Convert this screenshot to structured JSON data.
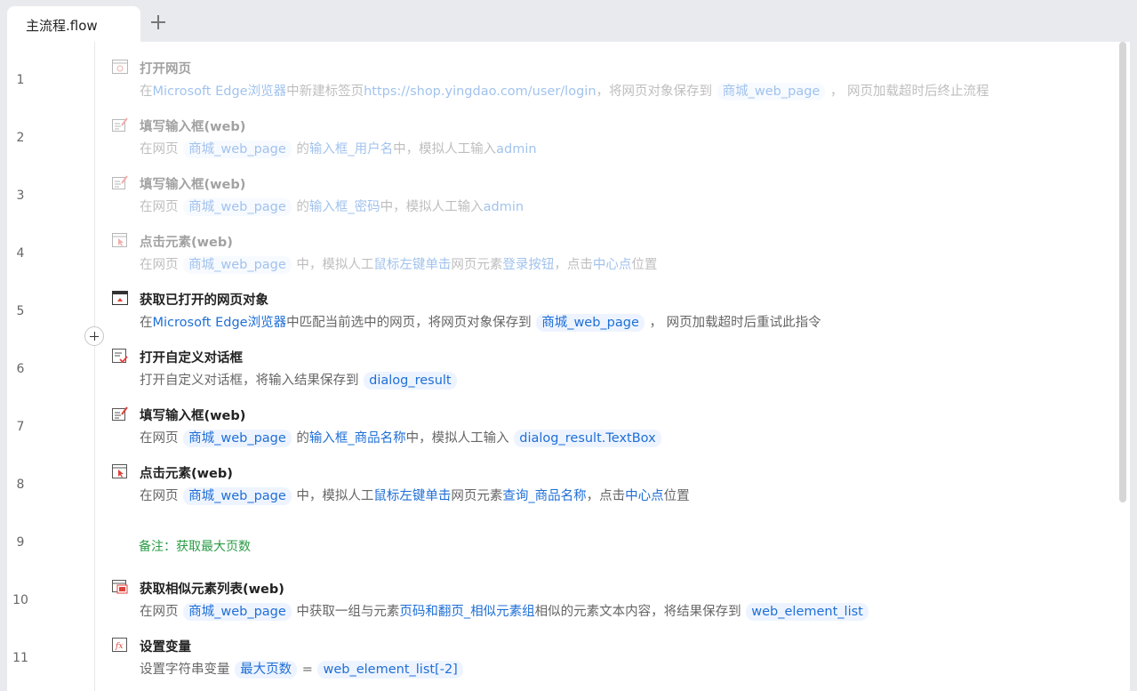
{
  "tabs": {
    "active_label": "主流程.flow",
    "add_label": "+"
  },
  "line_numbers": [
    "1",
    "2",
    "3",
    "4",
    "5",
    "6",
    "7",
    "8",
    "9",
    "10",
    "11"
  ],
  "steps": [
    {
      "title": "打开网页",
      "icon": "browser-open-icon",
      "disabled": true,
      "desc": [
        {
          "t": "在"
        },
        {
          "t": "Microsoft Edge浏览器",
          "k": "hl"
        },
        {
          "t": "中新建标签页"
        },
        {
          "t": "https://shop.yingdao.com/user/login",
          "k": "hl"
        },
        {
          "t": "，将网页对象保存到 "
        },
        {
          "t": "商城_web_page",
          "k": "chip"
        },
        {
          "t": " ， 网页加载超时后终止流程"
        }
      ]
    },
    {
      "title": "填写输入框(web)",
      "icon": "input-fill-icon",
      "disabled": true,
      "desc": [
        {
          "t": "在网页 "
        },
        {
          "t": "商城_web_page",
          "k": "chip"
        },
        {
          "t": " 的"
        },
        {
          "t": "输入框_用户名",
          "k": "hl"
        },
        {
          "t": "中，模拟人工输入"
        },
        {
          "t": "admin",
          "k": "hl"
        }
      ]
    },
    {
      "title": "填写输入框(web)",
      "icon": "input-fill-icon",
      "disabled": true,
      "desc": [
        {
          "t": "在网页 "
        },
        {
          "t": "商城_web_page",
          "k": "chip"
        },
        {
          "t": " 的"
        },
        {
          "t": "输入框_密码",
          "k": "hl"
        },
        {
          "t": "中，模拟人工输入"
        },
        {
          "t": "admin",
          "k": "hl"
        }
      ]
    },
    {
      "title": "点击元素(web)",
      "icon": "click-element-icon",
      "disabled": true,
      "desc": [
        {
          "t": "在网页 "
        },
        {
          "t": "商城_web_page",
          "k": "chip"
        },
        {
          "t": " 中，模拟人工"
        },
        {
          "t": "鼠标左键单击",
          "k": "hl"
        },
        {
          "t": "网页元素"
        },
        {
          "t": "登录按钮",
          "k": "hl"
        },
        {
          "t": "，点击"
        },
        {
          "t": "中心点",
          "k": "hl"
        },
        {
          "t": "位置"
        }
      ]
    },
    {
      "title": "获取已打开的网页对象",
      "icon": "get-webpage-icon",
      "disabled": false,
      "desc": [
        {
          "t": "在"
        },
        {
          "t": "Microsoft Edge浏览器",
          "k": "hl"
        },
        {
          "t": "中匹配当前选中的网页，将网页对象保存到 "
        },
        {
          "t": "商城_web_page",
          "k": "chip"
        },
        {
          "t": " ， 网页加载超时后重试此指令"
        }
      ]
    },
    {
      "title": "打开自定义对话框",
      "icon": "dialog-icon",
      "disabled": false,
      "desc": [
        {
          "t": "打开自定义对话框，将输入结果保存到 "
        },
        {
          "t": "dialog_result",
          "k": "chip"
        }
      ]
    },
    {
      "title": "填写输入框(web)",
      "icon": "input-fill-icon",
      "disabled": false,
      "desc": [
        {
          "t": "在网页 "
        },
        {
          "t": "商城_web_page",
          "k": "chip"
        },
        {
          "t": " 的"
        },
        {
          "t": "输入框_商品名称",
          "k": "hl"
        },
        {
          "t": "中，模拟人工输入 "
        },
        {
          "t": "dialog_result.TextBox",
          "k": "chip"
        }
      ]
    },
    {
      "title": "点击元素(web)",
      "icon": "click-element-icon",
      "disabled": false,
      "desc": [
        {
          "t": "在网页 "
        },
        {
          "t": "商城_web_page",
          "k": "chip"
        },
        {
          "t": " 中，模拟人工"
        },
        {
          "t": "鼠标左键单击",
          "k": "hl"
        },
        {
          "t": "网页元素"
        },
        {
          "t": "查询_商品名称",
          "k": "hl"
        },
        {
          "t": "，点击"
        },
        {
          "t": "中心点",
          "k": "hl"
        },
        {
          "t": "位置"
        }
      ]
    },
    {
      "title": "获取相似元素列表(web)",
      "icon": "similar-elements-icon",
      "disabled": false,
      "desc": [
        {
          "t": "在网页 "
        },
        {
          "t": "商城_web_page",
          "k": "chip"
        },
        {
          "t": " 中获取一组与元素"
        },
        {
          "t": "页码和翻页_相似元素组",
          "k": "hl"
        },
        {
          "t": "相似的元素文本内容，将结果保存到 "
        },
        {
          "t": "web_element_list",
          "k": "chip"
        }
      ]
    },
    {
      "title": "设置变量",
      "icon": "set-variable-icon",
      "disabled": false,
      "desc": [
        {
          "t": "设置字符串变量 "
        },
        {
          "t": "最大页数",
          "k": "chip"
        },
        {
          "t": " = "
        },
        {
          "t": "web_element_list[-2]",
          "k": "chip"
        }
      ]
    }
  ],
  "note": "备注：获取最大页数",
  "colors": {
    "accent": "#1f6fd6",
    "note_green": "#2a9c45",
    "icon_red": "#e0413a"
  }
}
